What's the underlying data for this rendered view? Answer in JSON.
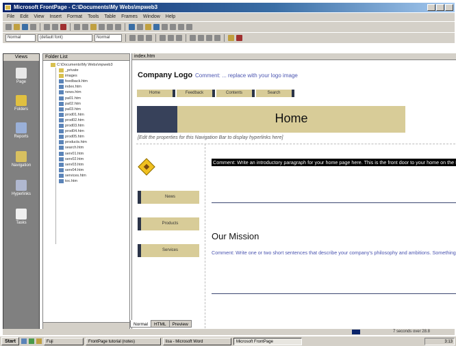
{
  "window": {
    "title": "Microsoft FrontPage - C:\\Documents\\My Webs\\mpweb3"
  },
  "menu": [
    "File",
    "Edit",
    "View",
    "Insert",
    "Format",
    "Tools",
    "Table",
    "Frames",
    "Window",
    "Help"
  ],
  "toolbar": {
    "style_value": "Normal",
    "font_value": "(default font)",
    "size_value": "Normal"
  },
  "views": {
    "header": "Views",
    "items": [
      "Page",
      "Folders",
      "Reports",
      "Navigation",
      "Hyperlinks",
      "Tasks"
    ]
  },
  "folder_list": {
    "header": "Folder List",
    "root": "C:\\Documents\\My Webs\\mpweb3",
    "folders": [
      "_private",
      "images"
    ],
    "files": [
      "feedback.htm",
      "index.htm",
      "news.htm",
      "pa01.htm",
      "pa02.htm",
      "pa03.htm",
      "prod01.htm",
      "prod02.htm",
      "prod03.htm",
      "prod04.htm",
      "prod05.htm",
      "products.htm",
      "search.htm",
      "serv01.htm",
      "serv02.htm",
      "serv03.htm",
      "serv04.htm",
      "services.htm",
      "toc.htm"
    ]
  },
  "editor": {
    "tab_label": "index.htm",
    "logo": "Company Logo",
    "logo_comment": "Comment: ... replace with your logo image",
    "nav_buttons": [
      "Home",
      "Feedback",
      "Contents",
      "Search"
    ],
    "banner": "Home",
    "nav_note": "[Edit the properties for this Navigation Bar to display hyperlinks here]",
    "side_buttons": [
      "News",
      "Products",
      "Services"
    ],
    "intro": "Comment: Write an introductory paragraph for your home page here. This is the front door to your home on the Internet. Invite visitors to step in and have a look around.",
    "mission_title": "Our Mission",
    "mission_text": "Comment: Write one or two short sentences that describe your company's philosophy and ambitions. Something like, \"To become the leading provider of ...\""
  },
  "view_tabs": [
    "Normal",
    "HTML",
    "Preview"
  ],
  "status": "7 seconds over 28.8",
  "taskbar": {
    "start": "Start",
    "items": [
      "Fuji",
      "FrontPage tutorial (notes)",
      "lisa - Microsoft Word",
      "Microsoft FrontPage"
    ],
    "clock": "3:13"
  },
  "colors": {
    "nav_tan": "#d8cc98",
    "nav_dark": "#37415a",
    "comment_blue": "#4a54b0"
  }
}
